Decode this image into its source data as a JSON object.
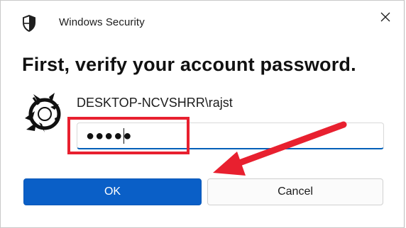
{
  "window": {
    "title": "Windows Security",
    "close_icon": "close-icon",
    "shield_icon": "windows-security-shield-icon"
  },
  "dialog": {
    "heading": "First, verify your account password.",
    "account": "DESKTOP-NCVSHRR\\rajst",
    "password_masked": "●●●●●"
  },
  "buttons": {
    "ok": "OK",
    "cancel": "Cancel"
  },
  "annotation": {
    "highlight_color": "#e8202f",
    "arrow_color": "#e8202f"
  },
  "colors": {
    "accent": "#0a5fc7",
    "field_underline": "#005fb8"
  }
}
